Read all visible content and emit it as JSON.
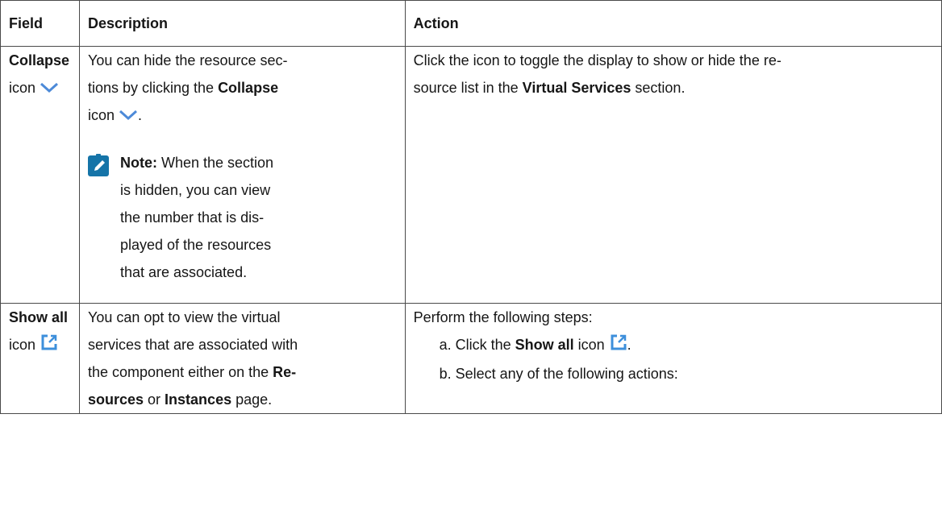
{
  "headers": {
    "field": "Field",
    "description": "Description",
    "action": "Action"
  },
  "row1": {
    "field_bold": "Collapse",
    "field_suffix": "icon",
    "icon": "chevron-down-icon",
    "desc_l1": "You can hide the resource sec-",
    "desc_l2_pre": "tions by clicking the ",
    "desc_l2_bold": "Collapse",
    "desc_l3_pre": "icon",
    "desc_l3_post": ".",
    "note_label": "Note:",
    "note_l1": " When the section",
    "note_l2": "is hidden, you can view",
    "note_l3": "the number that is dis-",
    "note_l4": "played of the resources",
    "note_l5": "that are associated.",
    "action_l1": "Click the icon to toggle the display to show or hide the re-",
    "action_l2_pre": "source list in the ",
    "action_l2_bold": "Virtual Services",
    "action_l2_post": " section."
  },
  "row2": {
    "field_bold": "Show all",
    "field_suffix": "icon",
    "icon": "launch-icon",
    "desc_l1": "You can opt to view the virtual",
    "desc_l2": "services that are associated with",
    "desc_l3_pre": "the component either on the ",
    "desc_l3_bold": "Re-",
    "desc_l4_bold1": "sources",
    "desc_l4_mid": " or ",
    "desc_l4_bold2": "Instances",
    "desc_l4_post": " page.",
    "action_intro": "Perform the following steps:",
    "step_a_pre": "a. Click the ",
    "step_a_bold": "Show all",
    "step_a_mid": " icon",
    "step_a_post": ".",
    "step_b": "b. Select any of the following actions:"
  },
  "colors": {
    "icon_blue": "#3d8fdb",
    "note_blue": "#1574a8",
    "chevron": "#4d8ad8"
  }
}
